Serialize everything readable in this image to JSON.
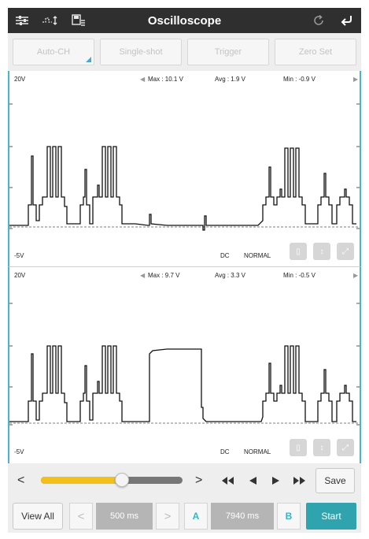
{
  "app": {
    "title": "Oscilloscope",
    "accent_color": "#49b6c3",
    "icons": [
      "settings-sliders-icon",
      "signal-adjust-icon",
      "save-list-icon",
      "refresh-icon",
      "back-icon"
    ]
  },
  "toolbar": {
    "auto_ch": "Auto-CH",
    "single_shot": "Single-shot",
    "trigger": "Trigger",
    "zero_set": "Zero Set"
  },
  "channels": [
    {
      "top_label": "20V",
      "max": "Max : 10.1 V",
      "avg": "Avg : 1.9 V",
      "min": "Min : -0.9 V",
      "bottom_label": "-5V",
      "coupling": "DC",
      "mode": "NORMAL",
      "waveform_description": "square-wave-bursts-with-flat-section"
    },
    {
      "top_label": "20V",
      "max": "Max : 9.7 V",
      "avg": "Avg : 3.3 V",
      "min": "Min : -0.5 V",
      "bottom_label": "-5V",
      "coupling": "DC",
      "mode": "NORMAL",
      "waveform_description": "square-wave-bursts-with-high-plateau"
    }
  ],
  "playback": {
    "position_fraction": 0.57,
    "slider_fill_color": "#f2c018",
    "save": "Save"
  },
  "bottom": {
    "view_all": "View All",
    "timebase": "500 ms",
    "cursor_a": "A",
    "cursor_time": "7940 ms",
    "cursor_b": "B",
    "start": "Start",
    "start_color": "#2fa4ae"
  }
}
